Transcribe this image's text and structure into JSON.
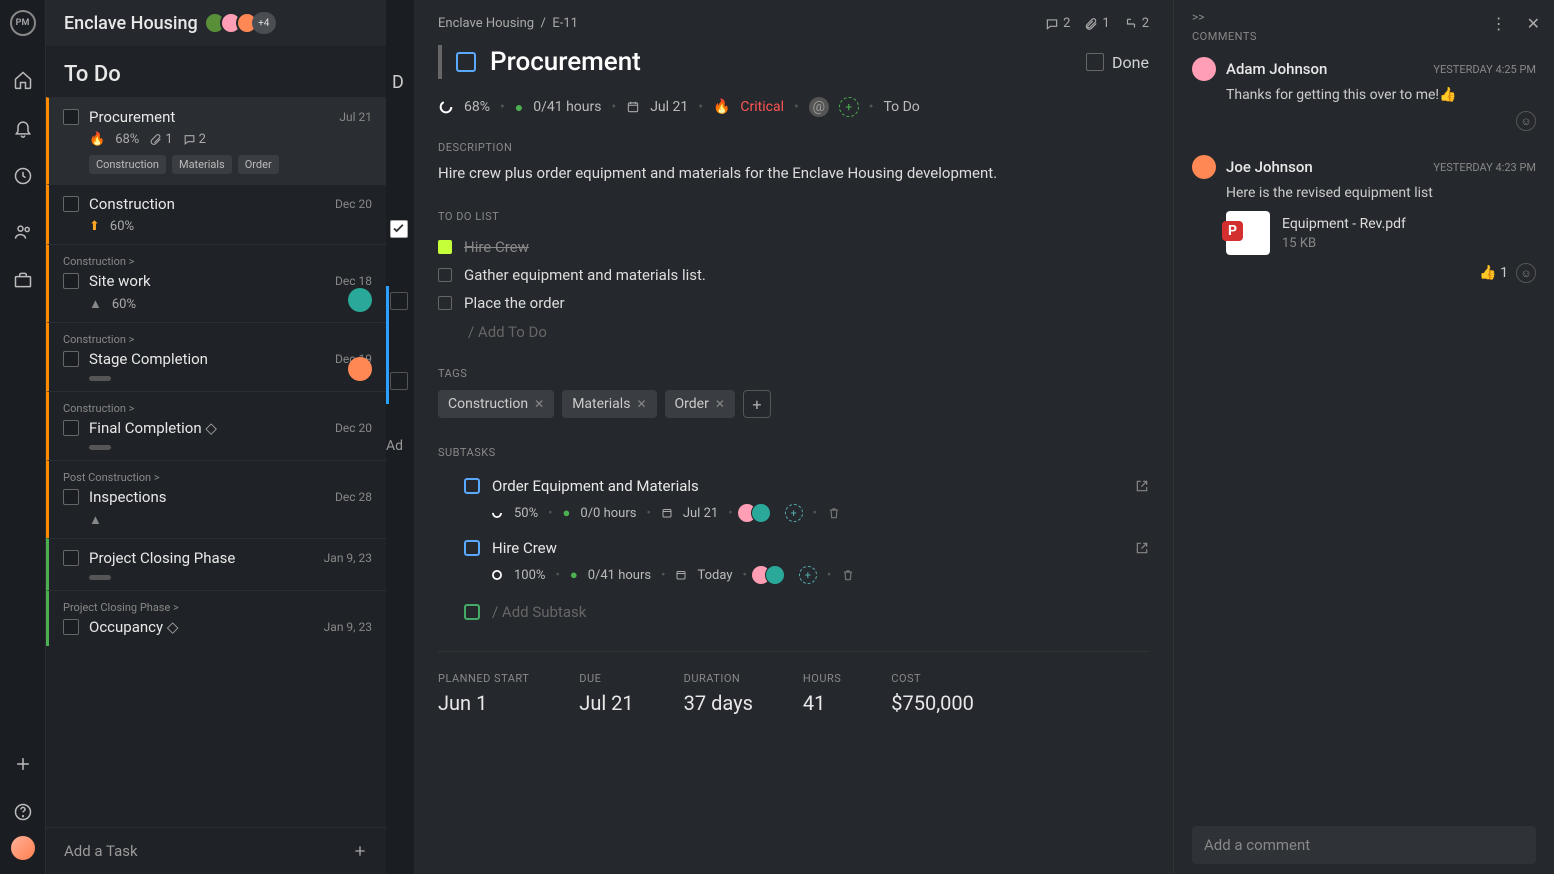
{
  "header": {
    "project_name": "Enclave Housing",
    "logo_text": "PM",
    "extra_avatars": "+4"
  },
  "sidebar": {
    "section": "To Do",
    "add_task": "Add a Task",
    "tasks": [
      {
        "name": "Procurement",
        "date": "Jul 21",
        "percent": "68%",
        "attachments": "1",
        "comments": "2",
        "tags": [
          "Construction",
          "Materials",
          "Order"
        ],
        "parent": "",
        "priority": "flame",
        "border": "orange",
        "selected": true
      },
      {
        "name": "Construction",
        "date": "Dec 20",
        "percent": "60%",
        "parent": "",
        "priority": "up",
        "border": "orange"
      },
      {
        "name": "Site work",
        "date": "Dec 18",
        "percent": "60%",
        "parent": "Construction >",
        "priority": "tri",
        "border": "orange",
        "avatar": "#2aa89a"
      },
      {
        "name": "Stage Completion",
        "date": "Dec 19",
        "parent": "Construction >",
        "border": "orange",
        "avatar": "#ff8855",
        "bar": true
      },
      {
        "name": "Final Completion",
        "date": "Dec 20",
        "parent": "Construction >",
        "border": "orange",
        "diamond": true,
        "bar": true
      },
      {
        "name": "Inspections",
        "date": "Dec 28",
        "parent": "Post Construction >",
        "border": "orange",
        "priority": "tri"
      },
      {
        "name": "Project Closing Phase",
        "date": "Jan 9, 23",
        "parent": "",
        "border": "green",
        "bar": true
      },
      {
        "name": "Occupancy",
        "date": "Jan 9, 23",
        "parent": "Project Closing Phase >",
        "border": "green",
        "diamond": true
      }
    ]
  },
  "phantom": {
    "letter": "D",
    "add_text": "Ad"
  },
  "detail": {
    "breadcrumb": {
      "project": "Enclave Housing",
      "id": "E-11"
    },
    "stats": {
      "comments": "2",
      "attachments": "1",
      "subtasks": "2"
    },
    "title": "Procurement",
    "done_label": "Done",
    "metrics": {
      "percent": "68%",
      "logged": "0",
      "total": "41 hours",
      "due": "Jul 21",
      "priority": "Critical",
      "status": "To Do"
    },
    "sections": {
      "description": "DESCRIPTION",
      "todo": "TO DO LIST",
      "tags": "TAGS",
      "subtasks": "SUBTASKS"
    },
    "description": "Hire crew plus order equipment and materials for the Enclave Housing development.",
    "todos": [
      {
        "text": "Hire Crew",
        "done": true
      },
      {
        "text": "Gather equipment and materials list.",
        "done": false
      },
      {
        "text": "Place the order",
        "done": false
      }
    ],
    "add_todo": "/ Add To Do",
    "tags": [
      "Construction",
      "Materials",
      "Order"
    ],
    "subtasks": [
      {
        "name": "Order Equipment and Materials",
        "percent": "50%",
        "hours": "0/0 hours",
        "date": "Jul 21"
      },
      {
        "name": "Hire Crew",
        "percent": "100%",
        "hours": "0/41 hours",
        "date": "Today"
      }
    ],
    "add_subtask": "/ Add Subtask",
    "bottom": [
      {
        "label": "PLANNED START",
        "value": "Jun 1"
      },
      {
        "label": "DUE",
        "value": "Jul 21"
      },
      {
        "label": "DURATION",
        "value": "37 days"
      },
      {
        "label": "HOURS",
        "value": "41"
      },
      {
        "label": "COST",
        "value": "$750,000"
      }
    ]
  },
  "comments": {
    "heading": "COMMENTS",
    "items": [
      {
        "author": "Adam Johnson",
        "time": "YESTERDAY 4:25 PM",
        "body": "Thanks for getting this over to me!👍",
        "avatar": "#ff9eb5"
      },
      {
        "author": "Joe Johnson",
        "time": "YESTERDAY 4:23 PM",
        "body": "Here is the revised equipment list",
        "avatar": "#ff8855",
        "attachment": {
          "name": "Equipment - Rev.pdf",
          "size": "15 KB"
        },
        "reactions": "👍 1"
      }
    ],
    "input_placeholder": "Add a comment"
  }
}
